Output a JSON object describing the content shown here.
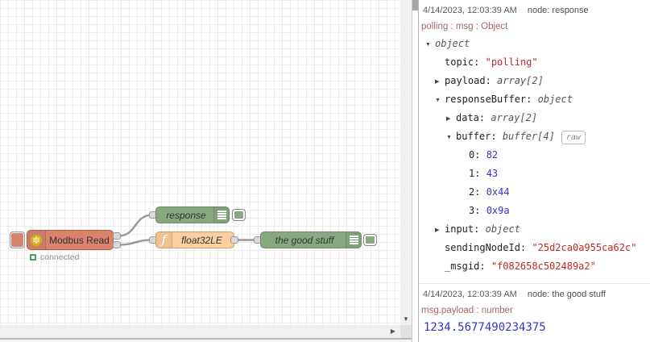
{
  "colors": {
    "modbus_node": "#d9836d",
    "debug_node": "#87a980",
    "function_node": "#fccf9e",
    "string_value": "#c22828",
    "number_value": "#3434c8",
    "meta_text": "#aa6666",
    "status_green": "#46a05e"
  },
  "icons": {
    "expanded": "▼",
    "collapsed": "▶",
    "scroll_down": "▼",
    "scroll_right": "▶",
    "modbus": "✽",
    "function": "ƒ"
  },
  "canvas": {
    "nodes": {
      "modbus": {
        "label": "Modbus Read",
        "status": "connected"
      },
      "response": {
        "label": "response"
      },
      "func": {
        "label": "float32LE"
      },
      "goodstuff": {
        "label": "the good stuff"
      }
    }
  },
  "debug": {
    "messages": [
      {
        "timestamp": "4/14/2023, 12:03:39 AM",
        "node": "node: response",
        "meta": "polling : msg : Object",
        "tree": [
          {
            "value": "object"
          },
          {
            "key": "topic:",
            "value": "\"polling\""
          },
          {
            "key": "payload:",
            "value": "array[2]"
          },
          {
            "key": "responseBuffer:",
            "value": "object"
          },
          {
            "key": "data:",
            "value": "array[2]"
          },
          {
            "key": "buffer:",
            "value": "buffer[4]",
            "badge": "raw"
          },
          {
            "key": "0:",
            "value": "82"
          },
          {
            "key": "1:",
            "value": "43"
          },
          {
            "key": "2:",
            "value": "0x44"
          },
          {
            "key": "3:",
            "value": "0x9a"
          },
          {
            "key": "input:",
            "value": "object"
          },
          {
            "key": "sendingNodeId:",
            "value": "\"25d2ca0a955ca62c\""
          },
          {
            "key": "_msgid:",
            "value": "\"f082658c502489a2\""
          }
        ]
      },
      {
        "timestamp": "4/14/2023, 12:03:39 AM",
        "node": "node: the good stuff",
        "meta": "msg.payload : number",
        "value": "1234.5677490234375"
      }
    ]
  }
}
